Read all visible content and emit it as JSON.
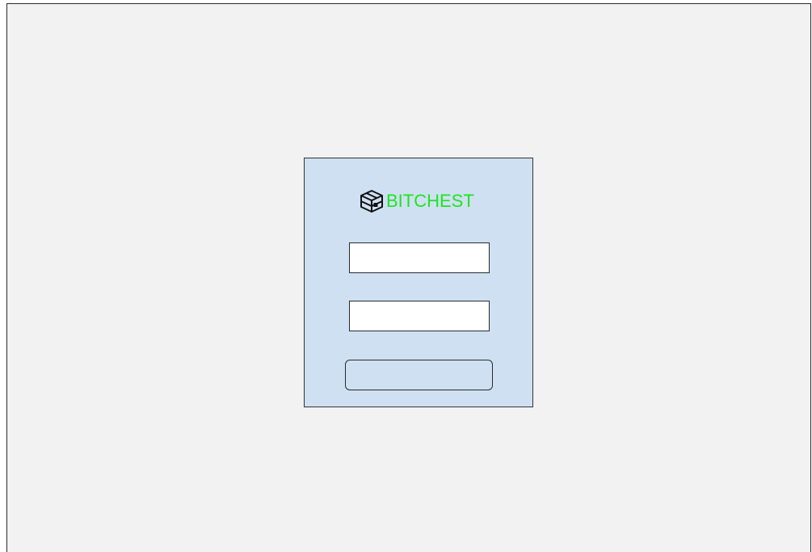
{
  "login": {
    "brand_name": "BITCHEST",
    "brand_color": "#1de51d",
    "logo_icon": "treasure-chest-icon",
    "username": {
      "value": "",
      "placeholder": ""
    },
    "password": {
      "value": "",
      "placeholder": ""
    },
    "submit_label": ""
  },
  "colors": {
    "page_background": "#f2f2f2",
    "panel_background": "#cfe0f2"
  }
}
